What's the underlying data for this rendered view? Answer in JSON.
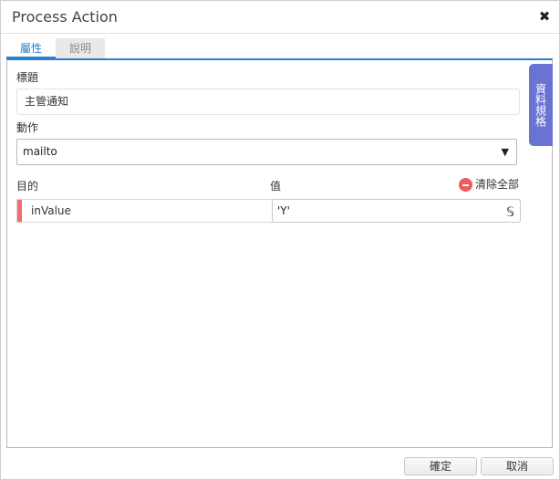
{
  "dialog": {
    "title": "Process Action",
    "close_symbol": "✖"
  },
  "tabs": [
    {
      "label": "屬性",
      "active": true
    },
    {
      "label": "說明",
      "active": false
    }
  ],
  "form": {
    "title_label": "標題",
    "title_value": "主管通知",
    "action_label": "動作",
    "action_value": "mailto",
    "target_label": "目的",
    "value_label": "值",
    "clear_all_label": "清除全部"
  },
  "mappings": [
    {
      "target": "inValue",
      "value": "'Y'"
    }
  ],
  "side_tab": {
    "label": "資料規格"
  },
  "footer": {
    "ok_label": "確定",
    "cancel_label": "取消"
  },
  "colors": {
    "accent": "#2a7fd0",
    "side_tab": "#6b73d2",
    "danger": "#f05a5a"
  },
  "icons": {
    "close": "close-icon",
    "clear": "minus-circle-icon",
    "script": "script-icon",
    "dropdown": "chevron-down-icon"
  }
}
